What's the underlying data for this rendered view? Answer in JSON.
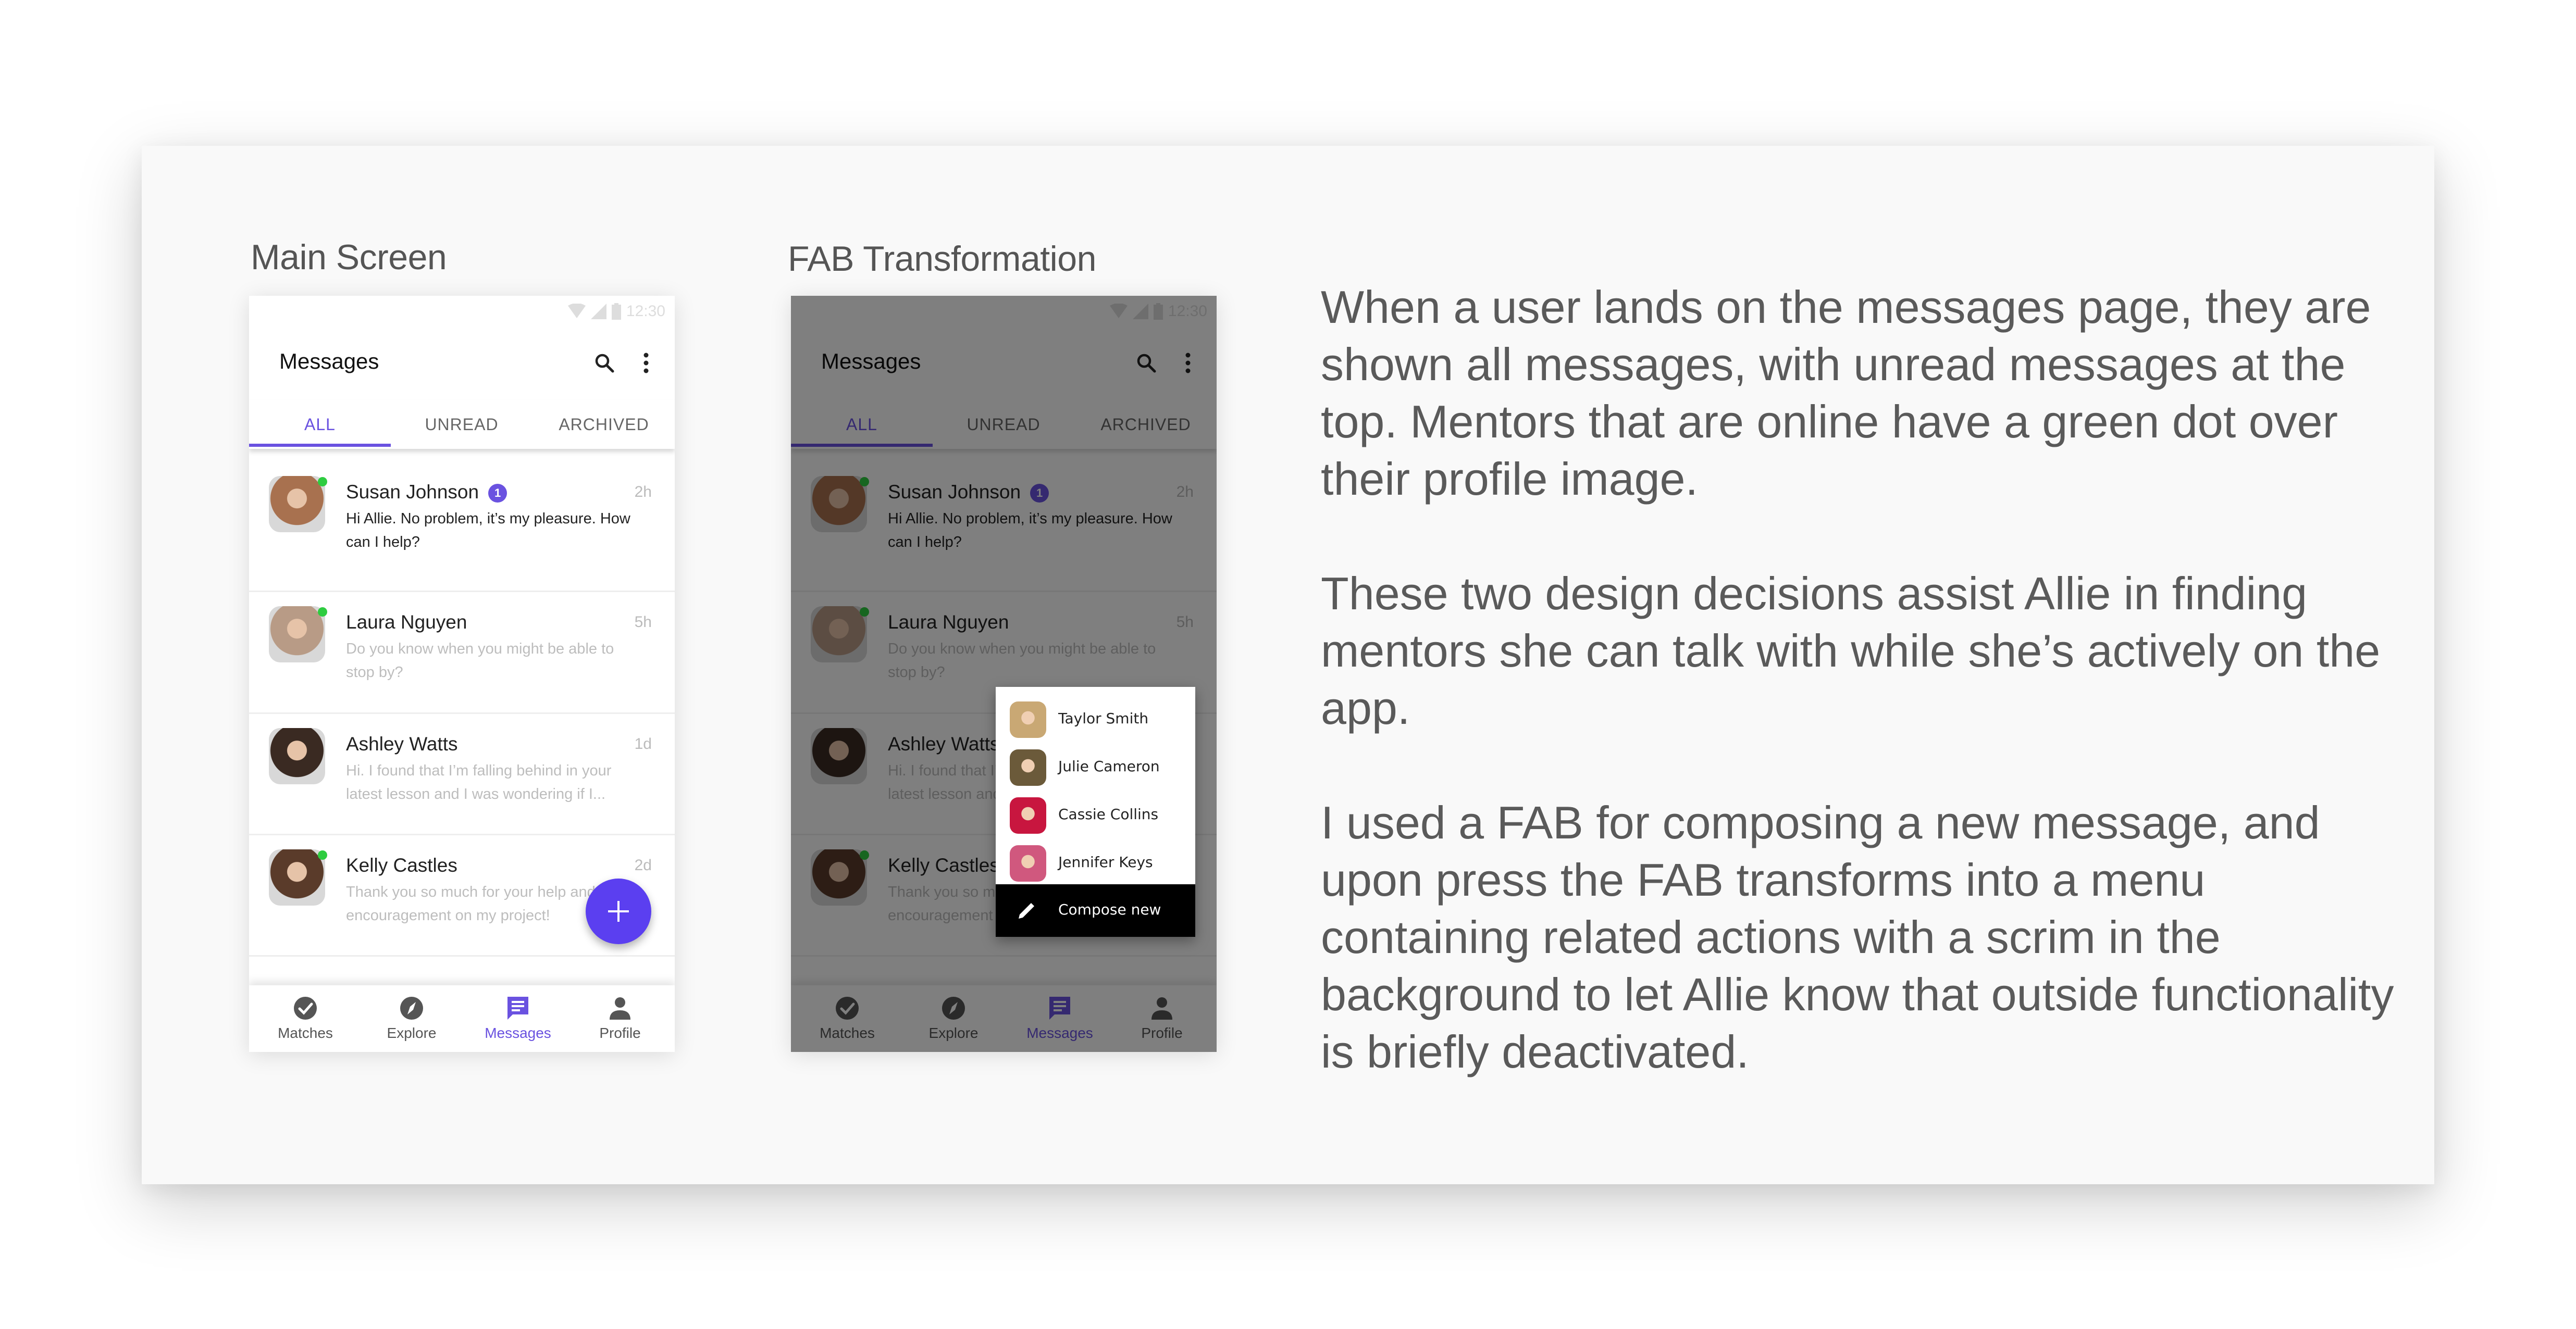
{
  "colors": {
    "accent": "#6a52e0",
    "fab": "#5b3ff0",
    "online": "#2ecc40",
    "card_bg": "#f9f9f9",
    "label_text": "#555555"
  },
  "sections": {
    "main_screen_label": "Main Screen",
    "fab_transformation_label": "FAB Transformation"
  },
  "phone": {
    "status_time": "12:30",
    "status_icons": [
      "wifi-icon",
      "signal-icon",
      "battery-icon"
    ],
    "title": "Messages",
    "actions": [
      "search-icon",
      "more-vert-icon"
    ],
    "tabs": [
      {
        "label": "ALL",
        "active": true
      },
      {
        "label": "UNREAD",
        "active": false
      },
      {
        "label": "ARCHIVED",
        "active": false
      }
    ],
    "conversations": [
      {
        "name": "Susan Johnson",
        "unread_count": "1",
        "time": "2h",
        "message": "Hi Allie. No problem, it’s my pleasure. How can I help?",
        "online": true,
        "unread": true,
        "avatar_color": "#a8714f"
      },
      {
        "name": "Laura Nguyen",
        "unread_count": null,
        "time": "5h",
        "message": "Do you know when you might be able to stop by?",
        "online": true,
        "unread": false,
        "avatar_color": "#b89b86"
      },
      {
        "name": "Ashley Watts",
        "unread_count": null,
        "time": "1d",
        "message": "Hi. I found that I’m falling behind in your latest lesson and I was wondering if I...",
        "online": false,
        "unread": false,
        "avatar_color": "#3a2a22"
      },
      {
        "name": "Kelly Castles",
        "unread_count": null,
        "time": "2d",
        "message": "Thank you so much for your help and encouragement on my project!",
        "online": true,
        "unread": false,
        "avatar_color": "#5a3b2a"
      }
    ],
    "bottom_nav": [
      {
        "label": "Matches",
        "icon": "check-circle-icon",
        "active": false
      },
      {
        "label": "Explore",
        "icon": "compass-icon",
        "active": false
      },
      {
        "label": "Messages",
        "icon": "chat-icon",
        "active": true
      },
      {
        "label": "Profile",
        "icon": "person-icon",
        "active": false
      }
    ],
    "fab_icon": "plus-icon"
  },
  "fab_menu": {
    "contacts": [
      {
        "name": "Taylor Smith",
        "avatar_color": "#c9a874"
      },
      {
        "name": "Julie Cameron",
        "avatar_color": "#6b5a3a"
      },
      {
        "name": "Cassie Collins",
        "avatar_color": "#c8163f"
      },
      {
        "name": "Jennifer Keys",
        "avatar_color": "#d0587e"
      }
    ],
    "compose_label": "Compose new",
    "compose_icon": "pencil-icon"
  },
  "description": {
    "paragraphs": [
      "When a user lands on the messages page, they are shown all messages, with unread messages at the top. Mentors that are online have a green dot over their profile image.",
      "These two design decisions assist Allie in finding mentors she can talk with while she’s actively on the app.",
      "I used a FAB for composing a new message, and upon press the FAB transforms into a menu containing related actions with a scrim in the background to let Allie know that outside functionality is briefly deactivated."
    ]
  }
}
